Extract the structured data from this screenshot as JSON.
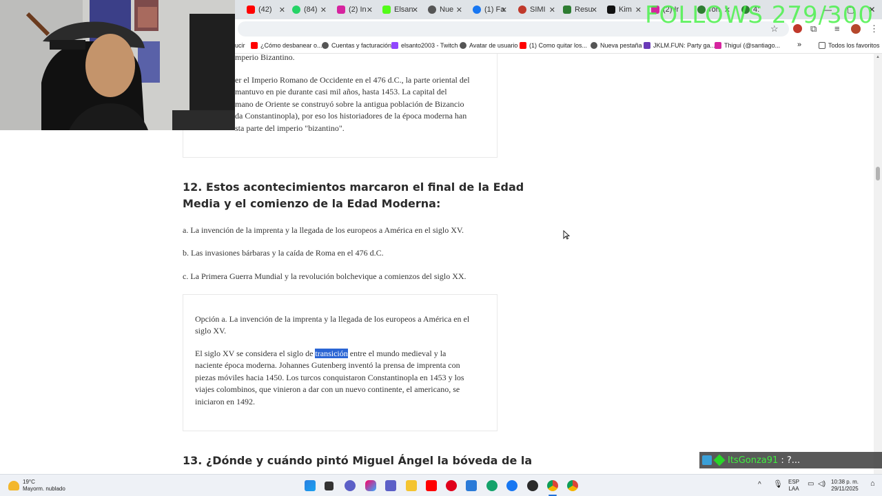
{
  "browser": {
    "tabs": [
      {
        "label": "(42)",
        "color": "#ff0000"
      },
      {
        "label": "(84)",
        "color": "#25d366"
      },
      {
        "label": "(2) In",
        "color": "#d6249f"
      },
      {
        "label": "Elsan",
        "color": "#53fc18"
      },
      {
        "label": "Nue",
        "color": "#555555"
      },
      {
        "label": "(1) Fa",
        "color": "#1877f2"
      },
      {
        "label": "SIMI",
        "color": "#c0392b"
      },
      {
        "label": "Resu",
        "color": "#2e7d32"
      },
      {
        "label": "Kim",
        "color": "#111111"
      },
      {
        "label": "(2) Ir",
        "color": "#d6249f"
      },
      {
        "label": "ron",
        "color": "#2e7d32"
      },
      {
        "label": "4:",
        "color": "#2e7d32"
      }
    ],
    "bookmarks": [
      {
        "label": "ucir",
        "color": "#999999"
      },
      {
        "label": "¿Cómo desbanear o...",
        "color": "#ff0000"
      },
      {
        "label": "Cuentas y facturación",
        "color": "#555555"
      },
      {
        "label": "elsanto2003 - Twitch",
        "color": "#9146ff"
      },
      {
        "label": "Avatar de usuario",
        "color": "#555555"
      },
      {
        "label": "(1) Como quitar los...",
        "color": "#ff0000"
      },
      {
        "label": "Nueva pestaña",
        "color": "#555555"
      },
      {
        "label": "JKLM.FUN: Party ga...",
        "color": "#6a3ab8"
      },
      {
        "label": "Thiguí (@santiago...",
        "color": "#d6249f"
      }
    ],
    "all_favorites": "Todos los favoritos"
  },
  "article": {
    "prev_text_1": "mperio Bizantino.",
    "prev_text_2_lines": [
      "er el Imperio Romano de Occidente en el 476 d.C., la parte oriental del",
      "mantuvo en pie durante casi mil años, hasta 1453. La capital del",
      "mano de Oriente se construyó sobre la antigua población de Bizancio",
      "da Constantinopla), por eso los historiadores de la época moderna han",
      "sta parte del imperio \"bizantino\"."
    ],
    "q12_title_lines": [
      "12. Estos acontecimientos marcaron el final de la Edad",
      "Media y el comienzo de la Edad Moderna:"
    ],
    "q12_options": [
      "a. La invención de la imprenta y la llegada de los europeos a América en el siglo XV.",
      "b. Las invasiones bárbaras y la caída de Roma en el 476 d.C.",
      "c. La Primera Guerra Mundial y la revolución bolchevique a comienzos del siglo XX."
    ],
    "q12_answer_lines": [
      "Opción a. La invención de la imprenta y la llegada de los europeos a América en el",
      "siglo XV."
    ],
    "q12_explanation": {
      "line1_before": "El siglo XV se considera el siglo de ",
      "line1_highlight": "transición",
      "line1_after": " entre el mundo medieval y la",
      "lines": [
        "naciente época moderna. Johannes Gutenberg inventó la prensa de imprenta con",
        "piezas móviles hacia 1450. Los turcos conquistaron Constantinopla en 1453 y los",
        "viajes colombinos, que vinieron a dar con un nuevo continente, el americano, se",
        "iniciaron en 1492."
      ]
    },
    "q13_title": "13. ¿Dónde y cuándo pintó Miguel Ángel la bóveda de la"
  },
  "overlays": {
    "follows": "FOLLOWS 279/300",
    "chat_user": "ItsGonza91",
    "chat_message": ": ?..."
  },
  "taskbar": {
    "temp": "19°C",
    "weather": "Mayorm. nublado",
    "lang_1": "ESP",
    "lang_2": "LAA",
    "time": "10:38 p. m.",
    "date": "29/11/2025"
  }
}
